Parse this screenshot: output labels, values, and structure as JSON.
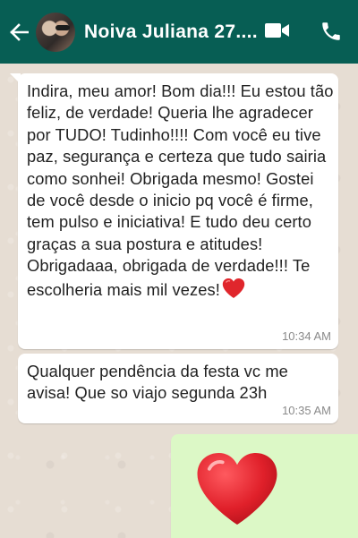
{
  "header": {
    "contact_name": "Noiva Juliana 27....",
    "icons": [
      "back-arrow-icon",
      "avatar",
      "video-camera-icon",
      "phone-icon"
    ],
    "bg_color": "#075e54"
  },
  "messages": [
    {
      "direction": "incoming",
      "text": "Indira, meu amor! Bom dia!!! Eu estou tão feliz, de verdade! Queria lhe agradecer por TUDO! Tudinho!!!! Com você eu tive paz, segurança e certeza que tudo sairia como sonhei! Obrigada mesmo! Gostei de você desde o inicio pq você é firme, tem pulso e iniciativa! E tudo deu certo graças a sua postura e atitudes! Obrigadaaa, obrigada de verdade!!! Te escolheria mais mil vezes!",
      "emoji": "red-heart",
      "time": "10:34 AM"
    },
    {
      "direction": "incoming",
      "text": "Qualquer pendência da festa vc me avisa! Que so viajo segunda 23h",
      "time": "10:35 AM"
    },
    {
      "direction": "outgoing",
      "emoji": "red-heart",
      "bg_color": "#dcf8c6"
    }
  ]
}
